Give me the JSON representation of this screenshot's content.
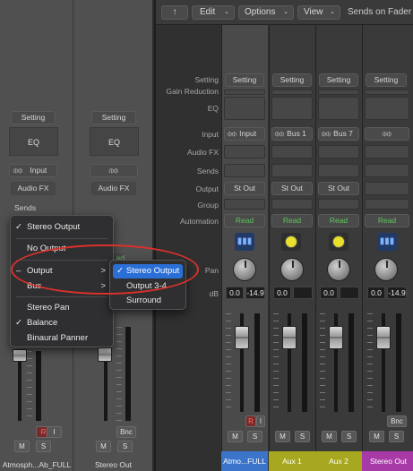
{
  "toolbar": {
    "edit": "Edit",
    "options": "Options",
    "view": "View",
    "sends_on_faders": "Sends on Fader"
  },
  "row_labels": {
    "setting": "Setting",
    "gain_reduction": "Gain Reduction",
    "eq": "EQ",
    "input": "Input",
    "audio_fx": "Audio FX",
    "sends": "Sends",
    "output": "Output",
    "group": "Group",
    "automation": "Automation",
    "pan": "Pan",
    "db": "dB"
  },
  "left_strip_1": {
    "setting": "Setting",
    "eq": "EQ",
    "input": "Input",
    "audio_fx": "Audio FX",
    "sends": "Sends",
    "r": "R",
    "i": "I",
    "m": "M",
    "s": "S",
    "name": "Atmosph...Ab_FULL"
  },
  "left_strip_2": {
    "setting": "Setting",
    "eq": "EQ",
    "audio_fx": "Audio FX",
    "read_partial": "ad",
    "m": "M",
    "s": "S",
    "bnc": "Bnc",
    "name": "Stereo Out"
  },
  "strips": [
    {
      "setting": "Setting",
      "input": "Input",
      "output": "St Out",
      "automation": "Read",
      "vol": "0.0",
      "peak": "-14.9",
      "r": "R",
      "i": "I",
      "m": "M",
      "s": "S",
      "name": "Atmo...FULL",
      "name_color": "#3b74c9"
    },
    {
      "setting": "Setting",
      "input": "Bus 1",
      "output": "St Out",
      "automation": "Read",
      "vol": "0.0",
      "peak": "",
      "m": "M",
      "s": "S",
      "name": "Aux 1",
      "name_color": "#a8a820"
    },
    {
      "setting": "Setting",
      "input": "Bus 7",
      "output": "St Out",
      "automation": "Read",
      "vol": "0.0",
      "peak": "",
      "m": "M",
      "s": "S",
      "name": "Aux 2",
      "name_color": "#a8a820"
    },
    {
      "setting": "Setting",
      "input": "",
      "output": "",
      "automation": "Read",
      "vol": "0.0",
      "peak": "-14.9",
      "m": "M",
      "s": "S",
      "bnc": "Bnc",
      "name": "Stereo Out",
      "name_color": "#a83aa8"
    }
  ],
  "menu": {
    "stereo_output": "Stereo Output",
    "no_output": "No Output",
    "output": "Output",
    "bus": "Bus",
    "stereo_pan": "Stereo Pan",
    "balance": "Balance",
    "binaural_panner": "Binaural Panner",
    "checkmark": "✓",
    "dash": "–",
    "arrow": ">"
  },
  "submenu": {
    "stereo_output": "Stereo Output",
    "output_3_4": "Output 3-4",
    "surround": "Surround",
    "checkmark": "✓"
  },
  "colors": {
    "highlight": "#2a6fd6",
    "annotation": "#d9312b"
  }
}
